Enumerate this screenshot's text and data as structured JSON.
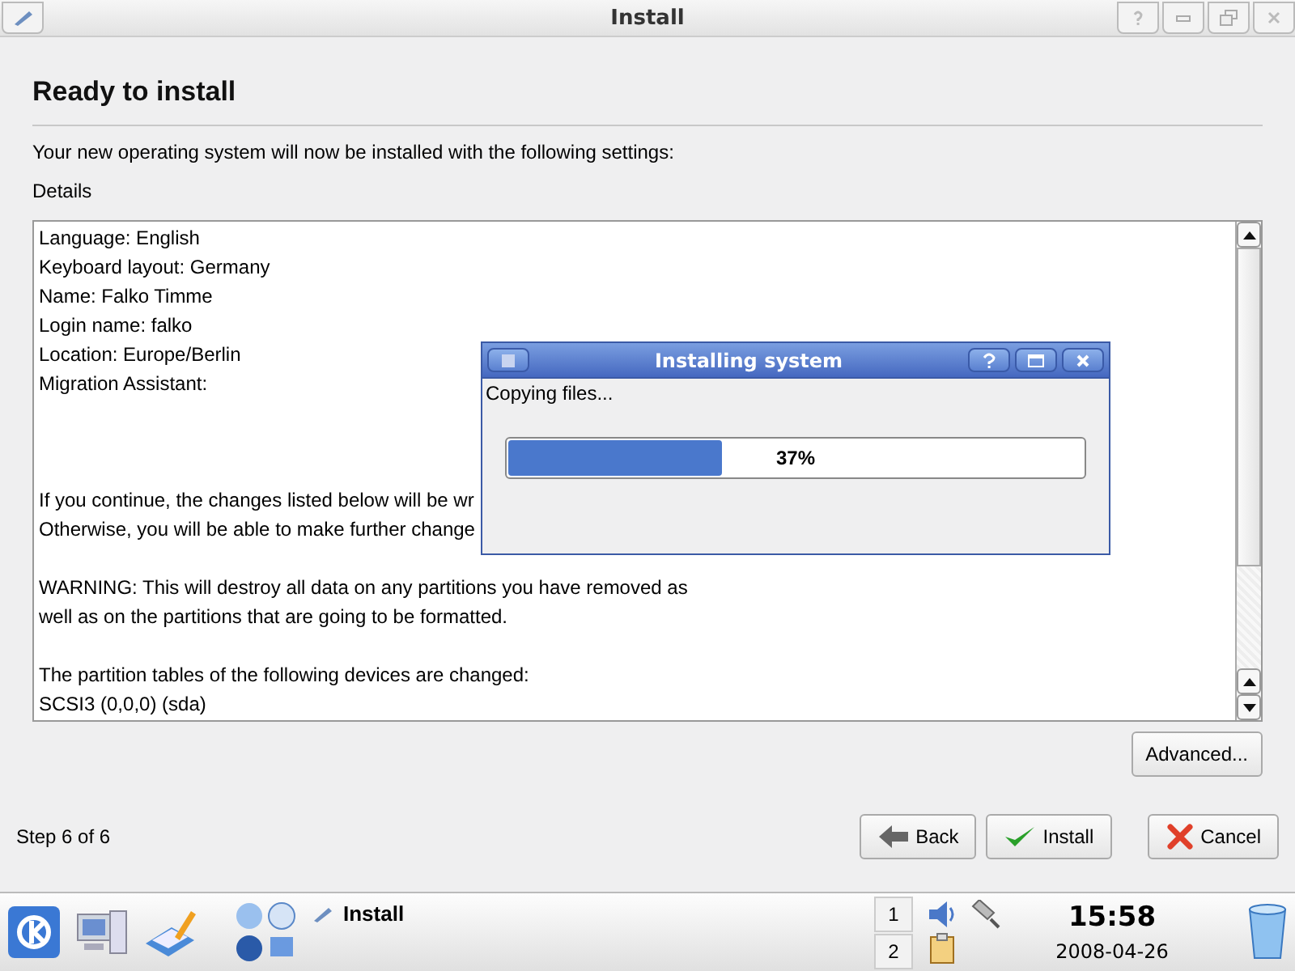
{
  "window": {
    "title": "Install"
  },
  "heading": "Ready to install",
  "intro": "Your new operating system will now be installed with the following settings:",
  "details_label": "Details",
  "details": [
    [
      "Language: English",
      "Keyboard layout: Germany",
      "Name: Falko Timme",
      "Login name: falko",
      "Location: Europe/Berlin",
      "Migration Assistant:"
    ],
    [
      "If you continue, the changes listed below will be wr",
      "Otherwise, you will be able to make further change"
    ],
    [
      "WARNING: This will destroy all data on any partitions you have removed as",
      "well as on the partitions that are going to be formatted."
    ],
    [
      "The partition tables of the following devices are changed:",
      "SCSI3 (0,0,0) (sda)"
    ]
  ],
  "advanced_button": "Advanced...",
  "step": "Step 6 of 6",
  "buttons": [
    {
      "kind": "back",
      "label": "Back"
    },
    {
      "kind": "install",
      "label": "Install"
    },
    {
      "kind": "cancel",
      "label": "Cancel"
    }
  ],
  "progress_dialog": {
    "title": "Installing system",
    "status": "Copying files...",
    "level": 0.37,
    "reading": "37%"
  },
  "taskbar": {
    "task": "Install",
    "desktops": [
      "1",
      "2"
    ],
    "clock": "15:58",
    "date": "2008-04-26"
  }
}
